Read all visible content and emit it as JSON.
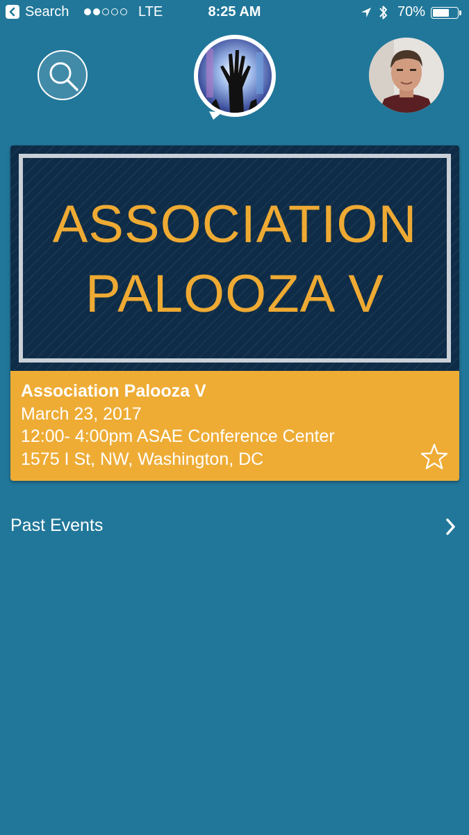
{
  "status_bar": {
    "back_label": "Search",
    "signal_bars_filled": 2,
    "signal_bars_total": 5,
    "carrier": "LTE",
    "time": "8:25 AM",
    "battery": "70%",
    "battery_level": 0.7
  },
  "header": {
    "search_icon": "search-icon",
    "logo_icon": "raised-hand-logo",
    "avatar_icon": "user-avatar"
  },
  "event_card": {
    "banner_line1": "ASSOCIATION",
    "banner_line2": "PALOOZA V",
    "title": "Association Palooza V",
    "date": "March 23, 2017",
    "time_venue": "12:00- 4:00pm ASAE Conference Center",
    "address": "1575 I St, NW, Washington, DC",
    "favorite_icon": "star-outline-icon"
  },
  "past_events": {
    "label": "Past Events",
    "chevron_icon": "chevron-right-icon"
  },
  "colors": {
    "background": "#217799",
    "card_banner": "#0e2c47",
    "accent": "#eeac35",
    "banner_text": "#eeaa33"
  }
}
